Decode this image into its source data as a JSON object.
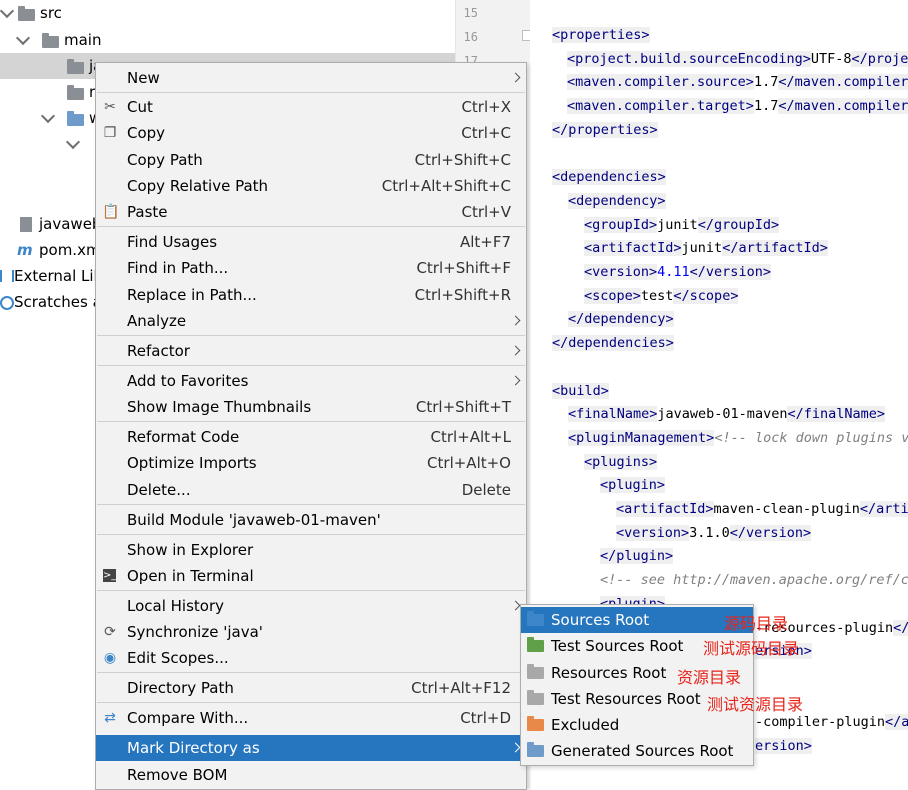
{
  "tree": {
    "src": "src",
    "main": "main",
    "row_j": "ja",
    "row_r": "r",
    "row_w": "w",
    "javaweb": "javaweb",
    "pom": "pom.xm",
    "pom_icon": "m",
    "external": "External Lib",
    "scratches": "Scratches a"
  },
  "gutter": {
    "lines": [
      "15",
      "16",
      "17"
    ]
  },
  "code": [
    [
      [
        "t",
        "<properties>"
      ]
    ],
    [
      [
        "t",
        "<project.build.sourceEncoding>"
      ],
      [
        "x",
        "UTF-8"
      ],
      [
        "t",
        "</projec"
      ]
    ],
    [
      [
        "t",
        "<maven.compiler.source>"
      ],
      [
        "x",
        "1.7"
      ],
      [
        "t",
        "</maven.compiler."
      ]
    ],
    [
      [
        "t",
        "<maven.compiler.target>"
      ],
      [
        "x",
        "1.7"
      ],
      [
        "t",
        "</maven.compiler."
      ]
    ],
    [
      [
        "t",
        "</properties>"
      ]
    ],
    [],
    [
      [
        "t",
        "<dependencies>"
      ]
    ],
    [
      [
        "t",
        "<dependency>"
      ]
    ],
    [
      [
        "t",
        "<groupId>"
      ],
      [
        "x",
        "junit"
      ],
      [
        "t",
        "</groupId>"
      ]
    ],
    [
      [
        "t",
        "<artifactId>"
      ],
      [
        "x",
        "junit"
      ],
      [
        "t",
        "</artifactId>"
      ]
    ],
    [
      [
        "t",
        "<version>"
      ],
      [
        "n",
        "4.11"
      ],
      [
        "t",
        "</version>"
      ]
    ],
    [
      [
        "t",
        "<scope>"
      ],
      [
        "x",
        "test"
      ],
      [
        "t",
        "</scope>"
      ]
    ],
    [
      [
        "t",
        "</dependency>"
      ]
    ],
    [
      [
        "t",
        "</dependencies>"
      ]
    ],
    [],
    [
      [
        "t",
        "<build>"
      ]
    ],
    [
      [
        "t",
        "<finalName>"
      ],
      [
        "x",
        "javaweb-01-maven"
      ],
      [
        "t",
        "</finalName>"
      ]
    ],
    [
      [
        "t",
        "<pluginManagement>"
      ],
      [
        "c",
        "<!-- lock down plugins ve"
      ]
    ],
    [
      [
        "t",
        "<plugins>"
      ]
    ],
    [
      [
        "t",
        "<plugin>"
      ]
    ],
    [
      [
        "t",
        "<artifactId>"
      ],
      [
        "x",
        "maven-clean-plugin"
      ],
      [
        "t",
        "</artif"
      ]
    ],
    [
      [
        "t",
        "<version>"
      ],
      [
        "x",
        "3.1.0"
      ],
      [
        "t",
        "</version>"
      ]
    ],
    [
      [
        "t",
        "</plugin>"
      ]
    ],
    [
      [
        "c",
        "<!-- see http://maven.apache.org/ref/cu"
      ]
    ],
    [
      [
        "t",
        "<plugin>"
      ]
    ],
    [
      [
        "x",
        "-resources-plugin"
      ],
      [
        "t",
        "</a"
      ]
    ],
    [
      [
        "t",
        "ersion>"
      ]
    ],
    [],
    [],
    [
      [
        "x",
        "-compiler-plugin"
      ],
      [
        "t",
        "</ar"
      ]
    ],
    [
      [
        "t",
        "ersion>"
      ]
    ]
  ],
  "menu": {
    "new": "New",
    "cut": "Cut",
    "cut_sc": "Ctrl+X",
    "copy": "Copy",
    "copy_sc": "Ctrl+C",
    "copy_path": "Copy Path",
    "copy_path_sc": "Ctrl+Shift+C",
    "copy_rel": "Copy Relative Path",
    "copy_rel_sc": "Ctrl+Alt+Shift+C",
    "paste": "Paste",
    "paste_sc": "Ctrl+V",
    "find_usages": "Find Usages",
    "find_usages_sc": "Alt+F7",
    "find_path": "Find in Path...",
    "find_path_sc": "Ctrl+Shift+F",
    "replace_path": "Replace in Path...",
    "replace_path_sc": "Ctrl+Shift+R",
    "analyze": "Analyze",
    "refactor": "Refactor",
    "add_fav": "Add to Favorites",
    "show_thumbs": "Show Image Thumbnails",
    "show_thumbs_sc": "Ctrl+Shift+T",
    "reformat": "Reformat Code",
    "reformat_sc": "Ctrl+Alt+L",
    "optimize": "Optimize Imports",
    "optimize_sc": "Ctrl+Alt+O",
    "delete": "Delete...",
    "delete_sc": "Delete",
    "build_module": "Build Module 'javaweb-01-maven'",
    "show_explorer": "Show in Explorer",
    "open_terminal": "Open in Terminal",
    "local_history": "Local History",
    "sync": "Synchronize 'java'",
    "edit_scopes": "Edit Scopes...",
    "dir_path": "Directory Path",
    "dir_path_sc": "Ctrl+Alt+F12",
    "compare": "Compare With...",
    "compare_sc": "Ctrl+D",
    "mark_dir": "Mark Directory as",
    "remove_bom": "Remove BOM"
  },
  "submenu": {
    "sources_root": "Sources Root",
    "test_sources_root": "Test Sources Root",
    "resources_root": "Resources Root",
    "test_resources_root": "Test Resources Root",
    "excluded": "Excluded",
    "generated_sources_root": "Generated Sources Root"
  },
  "annotations": {
    "sources": "源码目录",
    "test_sources": "测试源码目录",
    "resources": "资源目录",
    "test_resources": "测试资源目录"
  },
  "colors": {
    "highlight": "#2675bf",
    "annotation": "#e8231a",
    "sources_folder": "#3d86c9",
    "test_sources_folder": "#5fa048",
    "resources_folder": "#a8a8a8",
    "excluded_folder": "#e8894a"
  }
}
